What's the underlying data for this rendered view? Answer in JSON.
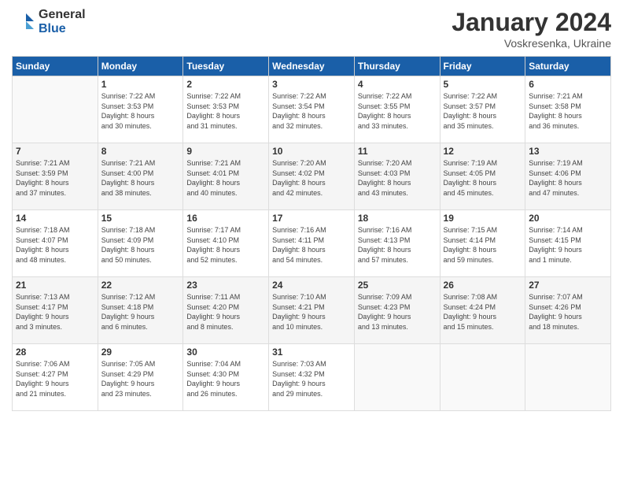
{
  "logo": {
    "general": "General",
    "blue": "Blue"
  },
  "title": {
    "month_year": "January 2024",
    "location": "Voskresenka, Ukraine"
  },
  "weekdays": [
    "Sunday",
    "Monday",
    "Tuesday",
    "Wednesday",
    "Thursday",
    "Friday",
    "Saturday"
  ],
  "weeks": [
    [
      {
        "day": "",
        "info": ""
      },
      {
        "day": "1",
        "info": "Sunrise: 7:22 AM\nSunset: 3:53 PM\nDaylight: 8 hours\nand 30 minutes."
      },
      {
        "day": "2",
        "info": "Sunrise: 7:22 AM\nSunset: 3:53 PM\nDaylight: 8 hours\nand 31 minutes."
      },
      {
        "day": "3",
        "info": "Sunrise: 7:22 AM\nSunset: 3:54 PM\nDaylight: 8 hours\nand 32 minutes."
      },
      {
        "day": "4",
        "info": "Sunrise: 7:22 AM\nSunset: 3:55 PM\nDaylight: 8 hours\nand 33 minutes."
      },
      {
        "day": "5",
        "info": "Sunrise: 7:22 AM\nSunset: 3:57 PM\nDaylight: 8 hours\nand 35 minutes."
      },
      {
        "day": "6",
        "info": "Sunrise: 7:21 AM\nSunset: 3:58 PM\nDaylight: 8 hours\nand 36 minutes."
      }
    ],
    [
      {
        "day": "7",
        "info": "Sunrise: 7:21 AM\nSunset: 3:59 PM\nDaylight: 8 hours\nand 37 minutes."
      },
      {
        "day": "8",
        "info": "Sunrise: 7:21 AM\nSunset: 4:00 PM\nDaylight: 8 hours\nand 38 minutes."
      },
      {
        "day": "9",
        "info": "Sunrise: 7:21 AM\nSunset: 4:01 PM\nDaylight: 8 hours\nand 40 minutes."
      },
      {
        "day": "10",
        "info": "Sunrise: 7:20 AM\nSunset: 4:02 PM\nDaylight: 8 hours\nand 42 minutes."
      },
      {
        "day": "11",
        "info": "Sunrise: 7:20 AM\nSunset: 4:03 PM\nDaylight: 8 hours\nand 43 minutes."
      },
      {
        "day": "12",
        "info": "Sunrise: 7:19 AM\nSunset: 4:05 PM\nDaylight: 8 hours\nand 45 minutes."
      },
      {
        "day": "13",
        "info": "Sunrise: 7:19 AM\nSunset: 4:06 PM\nDaylight: 8 hours\nand 47 minutes."
      }
    ],
    [
      {
        "day": "14",
        "info": "Sunrise: 7:18 AM\nSunset: 4:07 PM\nDaylight: 8 hours\nand 48 minutes."
      },
      {
        "day": "15",
        "info": "Sunrise: 7:18 AM\nSunset: 4:09 PM\nDaylight: 8 hours\nand 50 minutes."
      },
      {
        "day": "16",
        "info": "Sunrise: 7:17 AM\nSunset: 4:10 PM\nDaylight: 8 hours\nand 52 minutes."
      },
      {
        "day": "17",
        "info": "Sunrise: 7:16 AM\nSunset: 4:11 PM\nDaylight: 8 hours\nand 54 minutes."
      },
      {
        "day": "18",
        "info": "Sunrise: 7:16 AM\nSunset: 4:13 PM\nDaylight: 8 hours\nand 57 minutes."
      },
      {
        "day": "19",
        "info": "Sunrise: 7:15 AM\nSunset: 4:14 PM\nDaylight: 8 hours\nand 59 minutes."
      },
      {
        "day": "20",
        "info": "Sunrise: 7:14 AM\nSunset: 4:15 PM\nDaylight: 9 hours\nand 1 minute."
      }
    ],
    [
      {
        "day": "21",
        "info": "Sunrise: 7:13 AM\nSunset: 4:17 PM\nDaylight: 9 hours\nand 3 minutes."
      },
      {
        "day": "22",
        "info": "Sunrise: 7:12 AM\nSunset: 4:18 PM\nDaylight: 9 hours\nand 6 minutes."
      },
      {
        "day": "23",
        "info": "Sunrise: 7:11 AM\nSunset: 4:20 PM\nDaylight: 9 hours\nand 8 minutes."
      },
      {
        "day": "24",
        "info": "Sunrise: 7:10 AM\nSunset: 4:21 PM\nDaylight: 9 hours\nand 10 minutes."
      },
      {
        "day": "25",
        "info": "Sunrise: 7:09 AM\nSunset: 4:23 PM\nDaylight: 9 hours\nand 13 minutes."
      },
      {
        "day": "26",
        "info": "Sunrise: 7:08 AM\nSunset: 4:24 PM\nDaylight: 9 hours\nand 15 minutes."
      },
      {
        "day": "27",
        "info": "Sunrise: 7:07 AM\nSunset: 4:26 PM\nDaylight: 9 hours\nand 18 minutes."
      }
    ],
    [
      {
        "day": "28",
        "info": "Sunrise: 7:06 AM\nSunset: 4:27 PM\nDaylight: 9 hours\nand 21 minutes."
      },
      {
        "day": "29",
        "info": "Sunrise: 7:05 AM\nSunset: 4:29 PM\nDaylight: 9 hours\nand 23 minutes."
      },
      {
        "day": "30",
        "info": "Sunrise: 7:04 AM\nSunset: 4:30 PM\nDaylight: 9 hours\nand 26 minutes."
      },
      {
        "day": "31",
        "info": "Sunrise: 7:03 AM\nSunset: 4:32 PM\nDaylight: 9 hours\nand 29 minutes."
      },
      {
        "day": "",
        "info": ""
      },
      {
        "day": "",
        "info": ""
      },
      {
        "day": "",
        "info": ""
      }
    ]
  ]
}
